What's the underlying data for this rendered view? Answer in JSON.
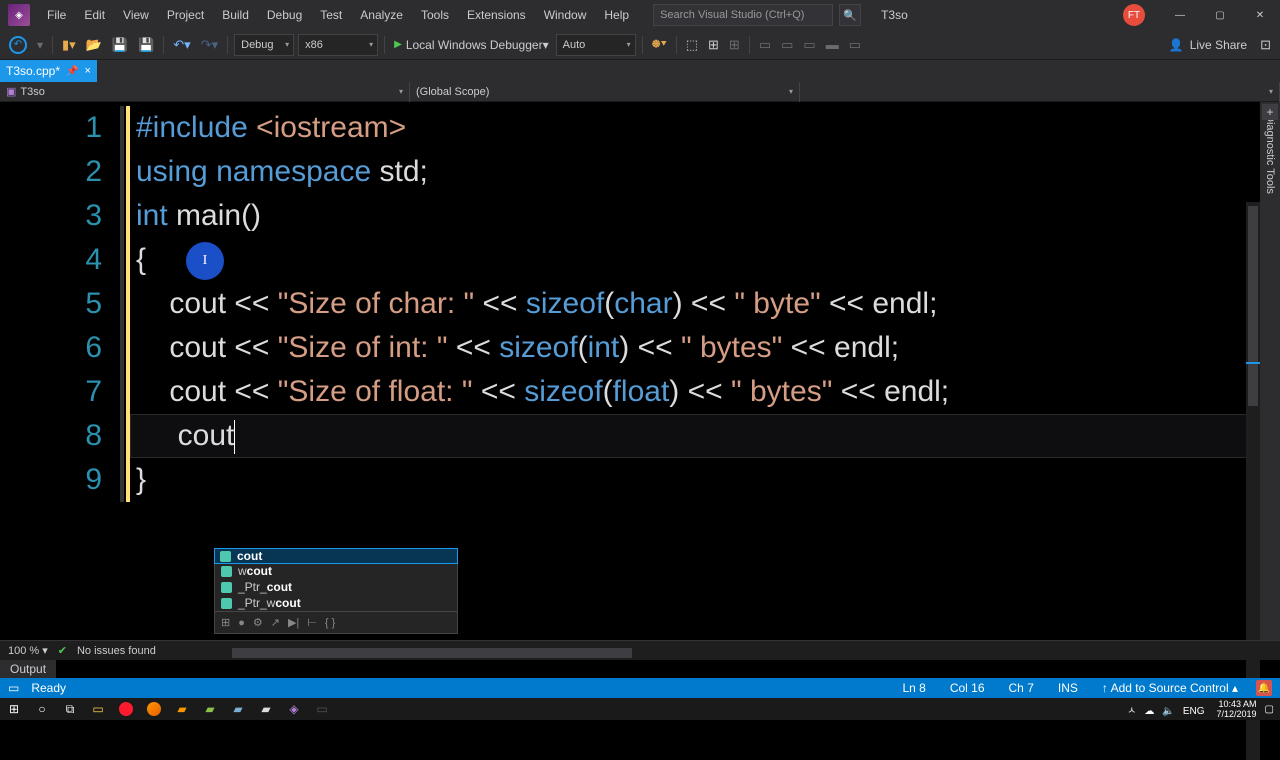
{
  "menu": [
    "File",
    "Edit",
    "View",
    "Project",
    "Build",
    "Debug",
    "Test",
    "Analyze",
    "Tools",
    "Extensions",
    "Window",
    "Help"
  ],
  "search_placeholder": "Search Visual Studio (Ctrl+Q)",
  "project_name": "T3so",
  "avatar_initials": "FT",
  "toolbar": {
    "config": "Debug",
    "platform": "x86",
    "debugger": "Local Windows Debugger",
    "mode": "Auto",
    "liveshare": "Live Share"
  },
  "tab": {
    "name": "T3so.cpp*",
    "pin": "📌",
    "close": "×"
  },
  "crumbs": {
    "project": "T3so",
    "scope": "(Global Scope)"
  },
  "right_panel": "Diagnostic Tools",
  "code": {
    "lines": [
      "1",
      "2",
      "3",
      "4",
      "5",
      "6",
      "7",
      "8",
      "9"
    ]
  },
  "intellisense": {
    "items": [
      {
        "pre": "",
        "match": "cout",
        "post": ""
      },
      {
        "pre": "w",
        "match": "cout",
        "post": ""
      },
      {
        "pre": "_Ptr_",
        "match": "cout",
        "post": ""
      },
      {
        "pre": "_Ptr_w",
        "match": "cout",
        "post": ""
      }
    ],
    "footer_icons": [
      "⊞",
      "●",
      "⚙",
      "↗",
      "▶|",
      "⊢",
      "{ }"
    ]
  },
  "statusline": {
    "zoom": "100 %",
    "issues": "No issues found"
  },
  "output_panel": "Output",
  "vsstatus": {
    "ready": "Ready",
    "ln": "Ln 8",
    "col": "Col 16",
    "ch": "Ch 7",
    "ins": "INS",
    "add_src": "Add to Source Control"
  },
  "taskbar": {
    "tray": [
      "ㅅ",
      "☁",
      "🔈",
      "ENG"
    ],
    "time": "10:43 AM",
    "date": "7/12/2019"
  },
  "tokens": {
    "l1": [
      "#include ",
      "<iostream>"
    ],
    "l2": [
      "using ",
      "namespace ",
      "std",
      ";"
    ],
    "l3": [
      "int ",
      "main",
      "()"
    ],
    "l4": [
      "{"
    ],
    "l5": [
      "    cout ",
      "<< ",
      "\"Size of char: \" ",
      "<< ",
      "sizeof",
      "(",
      "char",
      ")",
      " << ",
      "\" byte\" ",
      "<< ",
      "endl",
      ";"
    ],
    "l6": [
      "    cout ",
      "<< ",
      "\"Size of int: \" ",
      "<< ",
      "sizeof",
      "(",
      "int",
      ")",
      " << ",
      "\" bytes\" ",
      "<< ",
      "endl",
      ";"
    ],
    "l7": [
      "    cout ",
      "<< ",
      "\"Size of float: \" ",
      "<< ",
      "sizeof",
      "(",
      "float",
      ")",
      " << ",
      "\" bytes\" ",
      "<< ",
      "endl",
      ";"
    ],
    "l8": [
      "     cout"
    ],
    "l9": [
      "}"
    ]
  }
}
